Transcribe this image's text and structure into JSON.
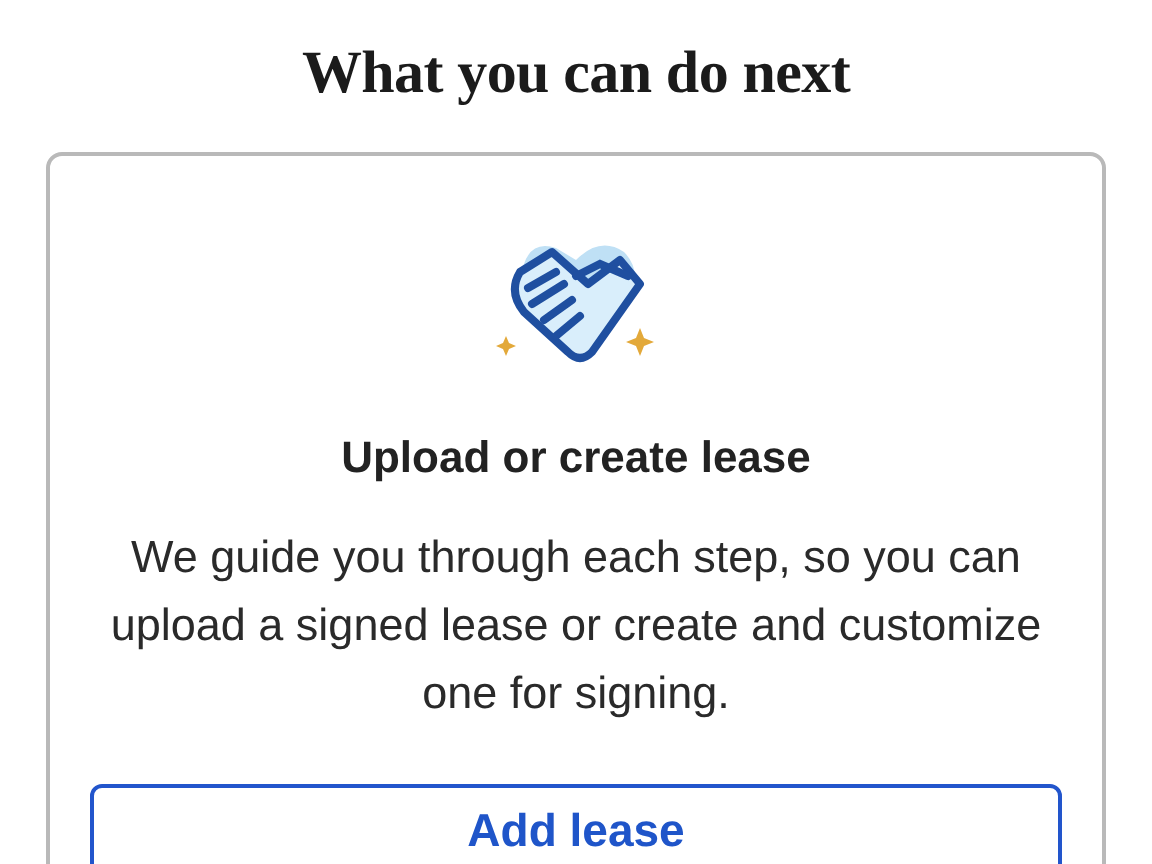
{
  "heading": "What you can do next",
  "card": {
    "title": "Upload or create lease",
    "description": "We guide you through each step, so you can upload a signed lease or create and customize one for signing.",
    "button": "Add lease"
  }
}
